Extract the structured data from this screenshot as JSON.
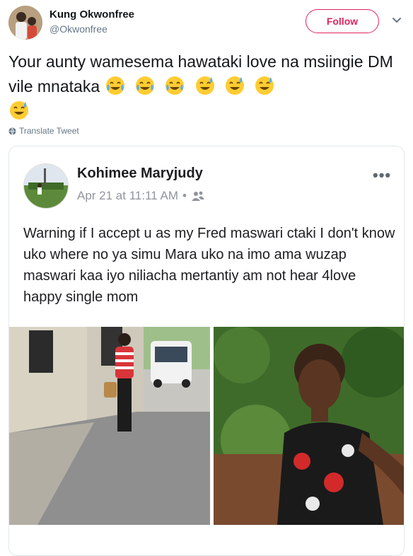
{
  "author": {
    "name": "Kung Okwonfree",
    "handle": "@Okwonfree"
  },
  "follow_label": "Follow",
  "tweet": {
    "text": "Your aunty wamesema hawataki love na msiingie DM vile mnataka",
    "emojis": [
      "tears-of-joy",
      "tears-of-joy",
      "tears-of-joy",
      "sweat-smile",
      "sweat-smile",
      "sweat-smile",
      "sweat-smile"
    ]
  },
  "translate_label": "Translate Tweet",
  "embedded_post": {
    "name": "Kohimee Maryjudy",
    "date": "Apr 21 at 11:11 AM",
    "text": "Warning if I accept u as my Fred maswari ctaki I don't know uko where no ya simu Mara uko na imo ama wuzap maswari kaa iyo niliacha mertantiy am not hear 4love happy single mom"
  },
  "colors": {
    "follow": "#e0245e",
    "muted": "#657786",
    "fb_muted": "#90949c"
  }
}
